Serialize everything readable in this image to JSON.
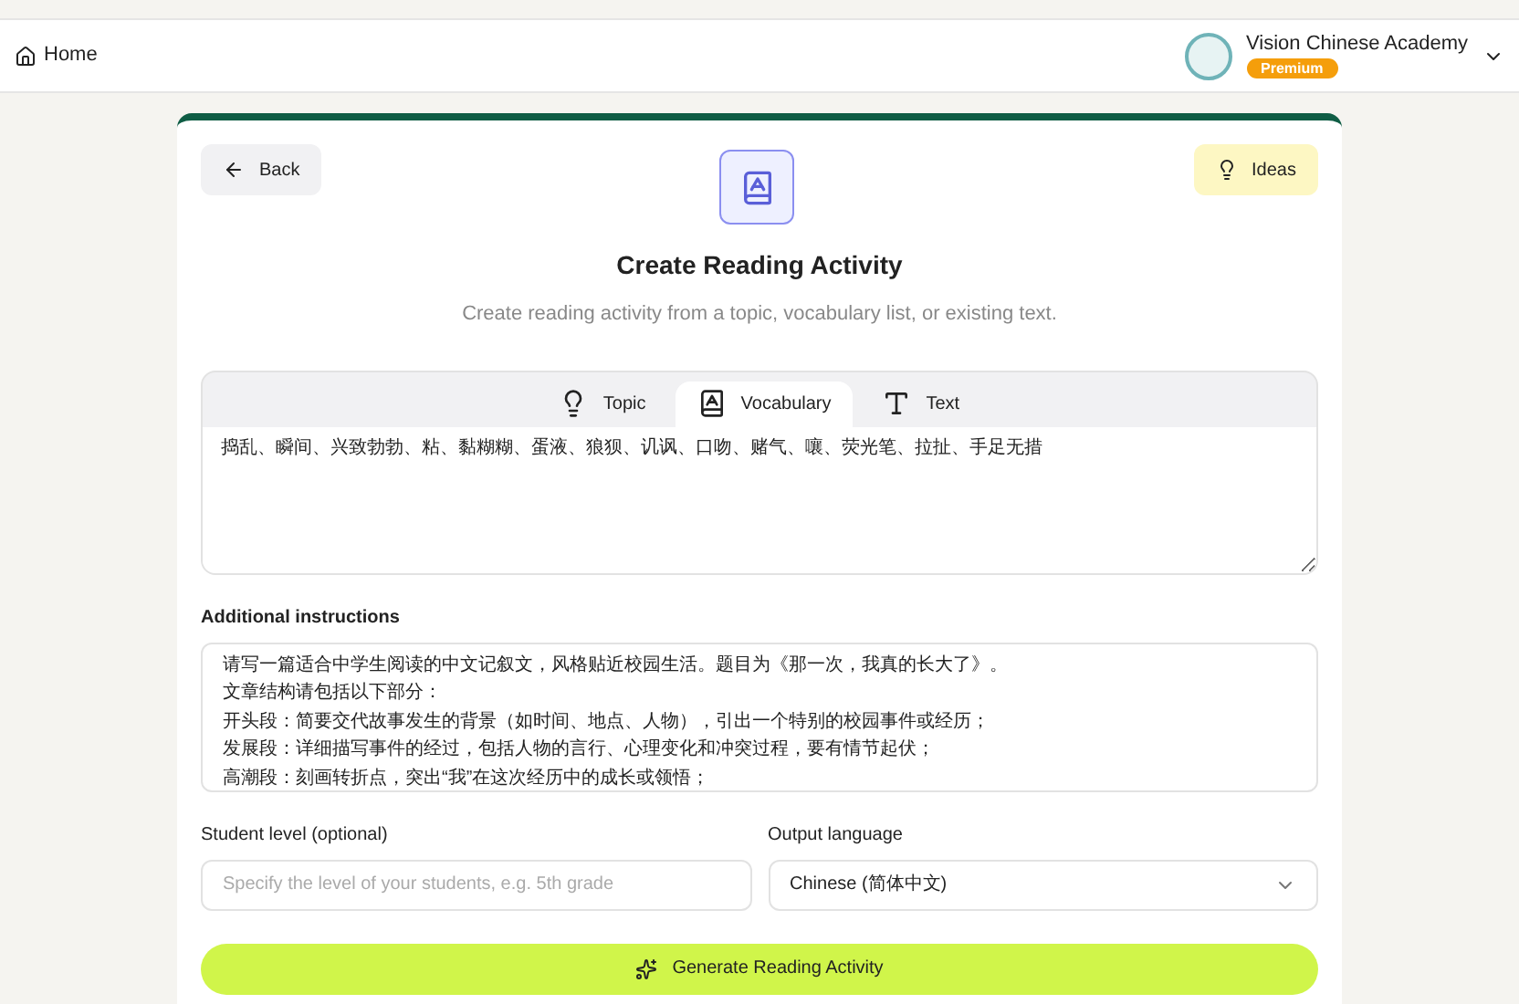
{
  "header": {
    "home": "Home",
    "account": {
      "name": "Vision Chinese Academy",
      "plan": "Premium"
    }
  },
  "toolbar": {
    "back": "Back",
    "ideas": "Ideas"
  },
  "title": "Create Reading Activity",
  "subtitle": "Create reading activity from a topic, vocabulary list, or existing text.",
  "tabs": [
    {
      "label": "Topic",
      "kind": "topic",
      "selected": false
    },
    {
      "label": "Vocabulary",
      "kind": "vocabulary",
      "selected": true
    },
    {
      "label": "Text",
      "kind": "text",
      "selected": false
    }
  ],
  "vocabulary_input": {
    "value": "捣乱、瞬间、兴致勃勃、粘、黏糊糊、蛋液、狼狈、讥讽、口吻、赌气、嚷、荧光笔、拉扯、手足无措"
  },
  "additional_instructions": {
    "label": "Additional instructions",
    "lines": [
      "请写一篇适合中学生阅读的中文记叙文，风格贴近校园生活。题目为《那一次，我真的长大了》。",
      "文章结构请包括以下部分：",
      "开头段：简要交代故事发生的背景（如时间、地点、人物），引出一个特别的校园事件或经历；",
      "发展段：详细描写事件的经过，包括人物的言行、心理变化和冲突过程，要有情节起伏；",
      "高潮段：刻画转折点，突出“我”在这次经历中的成长或领悟；"
    ]
  },
  "student_level": {
    "label": "Student level (optional)",
    "placeholder": "Specify the level of your students, e.g. 5th grade"
  },
  "output_language": {
    "label": "Output language",
    "value": "Chinese (简体中文)"
  },
  "generate_button": "Generate Reading Activity"
}
